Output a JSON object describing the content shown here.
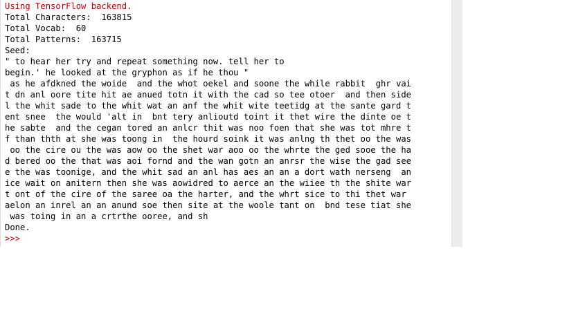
{
  "colors": {
    "stderr": "#c00000",
    "stdout": "#000000",
    "prompt": "#c00000",
    "background": "#ffffff",
    "scrollbar": "#ececec"
  },
  "shell": {
    "backend_message": "Using TensorFlow backend.",
    "total_characters": "Total Characters:  163815",
    "total_vocab": "Total Vocab:  60",
    "total_patterns": "Total Patterns:  163715",
    "seed_label": "Seed:",
    "seed_lines": [
      "\" to hear her try and repeat something now. tell her to",
      "begin.' he looked at the gryphon as if he thou \""
    ],
    "generated_lines": [
      " as he afdkned the woide  and the whot oekel and soone the while rabbit  ghr vai",
      "t dn anl oore tite hit ae anued totn it with the cad so tee otoer  and then side",
      "l the whit sade to the whit wat an anf the whit wite teetidg at the sante gard t",
      "ent snee  the would 'alt in  bnt tery anlioutd toint it thet wire the dinte oe t",
      "he sabte  and the cegan tored an anlcr thit was noo foen that she was tot mhre t",
      "f than thth at she was toong in  the hourd soink it was anlng th thet oo the was",
      " oo the cire ou the was aow oo the shet war aoo oo the whrte the ged sooe the ha",
      "d bered oo the that was aoi fornd and the wan gotn an anrsr the wise the gad see",
      "e the was toonige, and the whit sad an anl has aes an an a dort wath nerseng  an",
      "ice wait on anitern then she was aowidred to aerce an the wiiee th the shite war",
      "t ont of the cire of the saree oa the harter, and the whrt sice to thi thet war",
      "aelon an inrel an an anund soe then site at the woole tant on  bnd tese tiat she",
      " was toing in an a crtrthe ooree, and sh"
    ],
    "done": "Done.",
    "prompt": ">>>"
  }
}
